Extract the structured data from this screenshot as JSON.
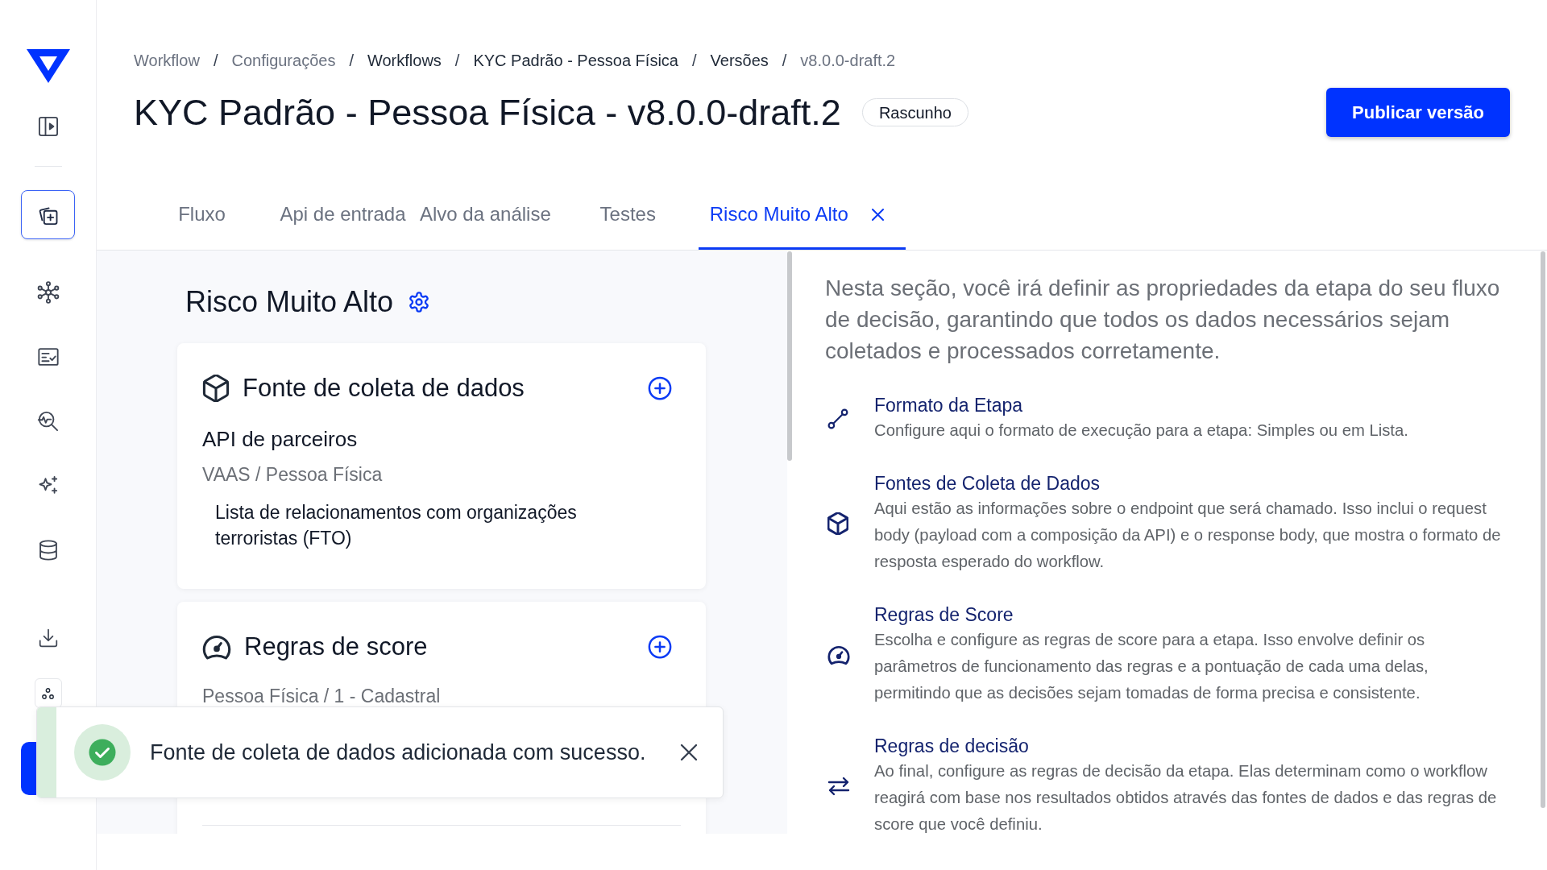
{
  "sidebar": {
    "items": [
      {
        "selected": true
      },
      {
        "selected": false
      },
      {
        "selected": false
      },
      {
        "selected": false
      },
      {
        "selected": false
      },
      {
        "selected": false
      }
    ]
  },
  "breadcrumb": {
    "separator": "/",
    "items": [
      {
        "label": "Workflow",
        "muted": true
      },
      {
        "label": "Configurações",
        "muted": true
      },
      {
        "label": "Workflows",
        "muted": false
      },
      {
        "label": "KYC Padrão - Pessoa Física",
        "muted": false
      },
      {
        "label": "Versões",
        "muted": false
      },
      {
        "label": "v8.0.0-draft.2",
        "muted": true
      }
    ]
  },
  "header": {
    "title": "KYC Padrão - Pessoa Física - v8.0.0-draft.2",
    "status": "Rascunho",
    "publish_button": "Publicar versão"
  },
  "tabs": [
    {
      "label": "Fluxo",
      "selected": false,
      "closable": false
    },
    {
      "label": "Api de entrada",
      "selected": false,
      "closable": false
    },
    {
      "label": "Alvo da análise",
      "selected": false,
      "closable": false
    },
    {
      "label": "Testes",
      "selected": false,
      "closable": false
    },
    {
      "label": "Risco Muito Alto",
      "selected": true,
      "closable": true
    }
  ],
  "stage": {
    "title": "Risco Muito Alto",
    "cards": [
      {
        "kind": "data_source",
        "title": "Fonte de coleta de dados",
        "name": "API de parceiros",
        "path": "VAAS / Pessoa Física",
        "entries": [
          "Lista de relacionamentos com organizações terroristas (FTO)"
        ]
      },
      {
        "kind": "score_rules",
        "title": "Regras de score",
        "path": "Pessoa Física / 1 - Cadastral"
      }
    ]
  },
  "help": {
    "intro": "Nesta seção, você irá definir as propriedades da etapa do seu fluxo de decisão, garantindo que todos os dados necessários sejam coletados e processados corretamente.",
    "sections": [
      {
        "kind": "format",
        "title": "Formato da Etapa",
        "description": "Configure aqui o formato de execução para a etapa: Simples ou em Lista."
      },
      {
        "kind": "data_sources",
        "title": "Fontes de Coleta de Dados",
        "description": "Aqui estão as informações sobre o endpoint que será chamado. Isso inclui o request body (payload com a composição da API) e o response body, que mostra o formato de resposta esperado do workflow."
      },
      {
        "kind": "score",
        "title": "Regras de Score",
        "description": "Escolha e configure as regras de score para a etapa. Isso envolve definir os parâmetros de funcionamento das regras e a pontuação de cada uma delas, permitindo que as decisões sejam tomadas de forma precisa e consistente."
      },
      {
        "kind": "decision",
        "title": "Regras de decisão",
        "description": "Ao final, configure as regras de decisão da etapa. Elas determinam como o workflow reagirá com base nos resultados obtidos através das fontes de dados e das regras de score que você definiu."
      }
    ]
  },
  "toast": {
    "kind": "success",
    "message": "Fonte de coleta de dados adicionada com sucesso."
  }
}
